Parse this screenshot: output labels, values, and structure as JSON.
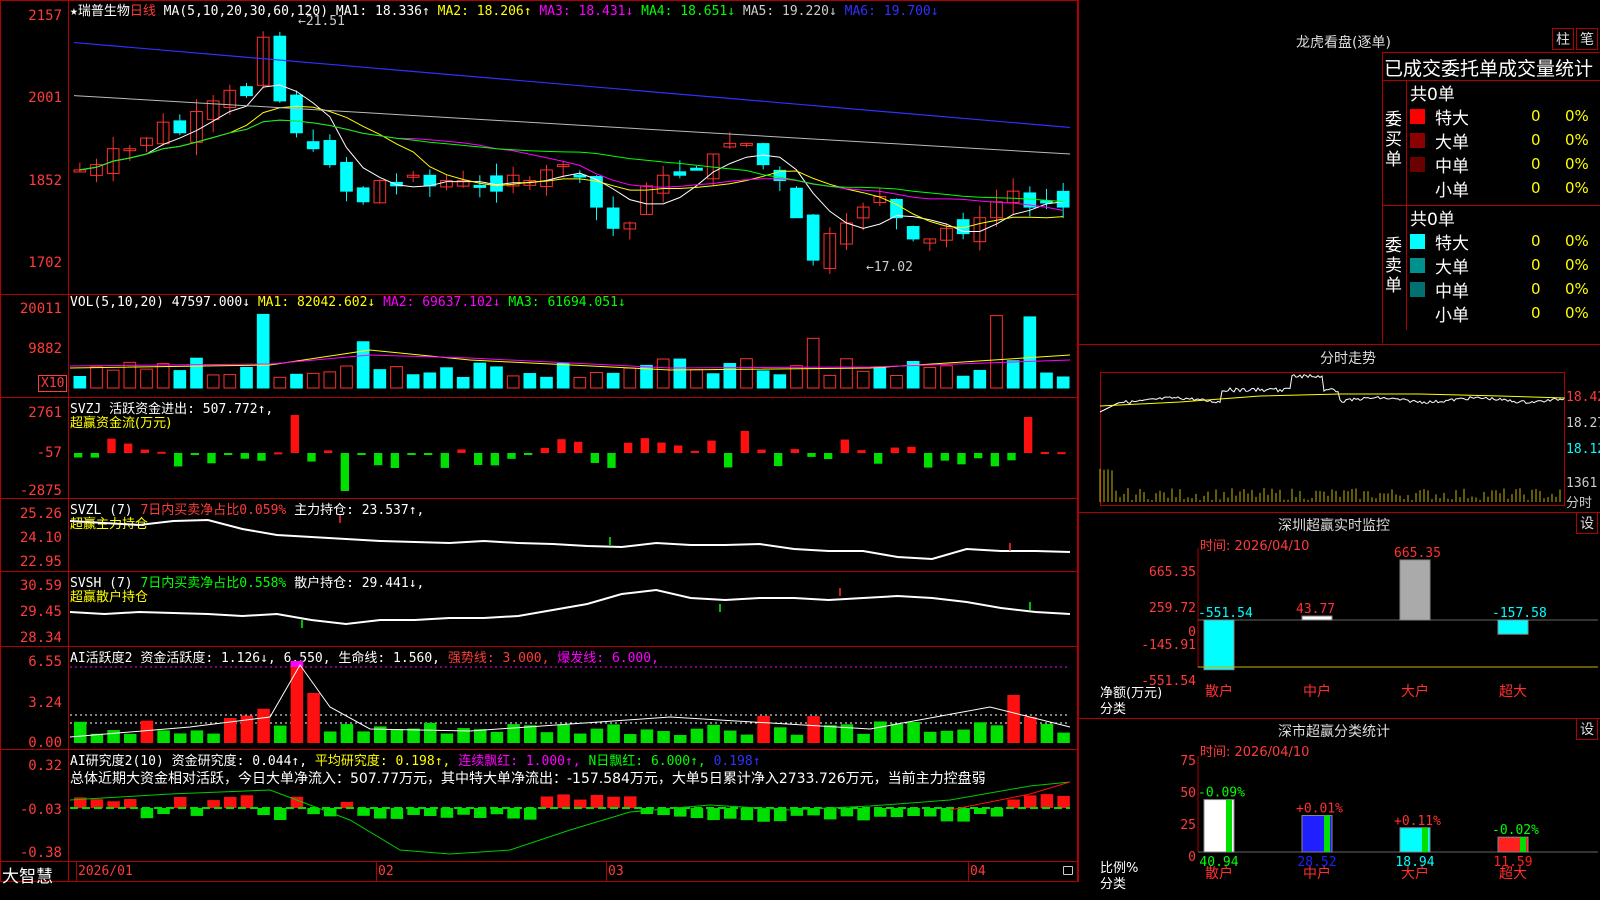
{
  "header": {
    "stock_label": "★瑞普生物",
    "period": "日线",
    "ma_def": "MA(5,10,20,30,60,120)",
    "ma1": "MA1: 18.336↑",
    "ma2": "MA2: 18.206↑",
    "ma3": "MA3: 18.431↓",
    "ma4": "MA4: 18.651↓",
    "ma5": "MA5: 19.220↓",
    "ma6": "MA6: 19.700↓"
  },
  "main_chart": {
    "y_ticks": [
      "2157",
      "2001",
      "1852",
      "1702"
    ],
    "high_label": "←21.51",
    "low_label": "←17.02"
  },
  "vol": {
    "def": "VOL(5,10,20)",
    "value": "47597.000↓",
    "ma1": "MA1: 82042.602↓",
    "ma2": "MA2: 69637.102↓",
    "ma3": "MA3: 61694.051↓",
    "y_ticks": [
      "20011",
      "9882"
    ],
    "unit": "X10"
  },
  "svzj": {
    "line1": "SVZJ  活跃资金进出: 507.772↑,",
    "line2": "超赢资金流(万元)",
    "y_ticks": [
      "2761",
      "-57",
      "-2875"
    ]
  },
  "svzl": {
    "def": "SVZL (7)",
    "ratio": "7日内买卖净占比0.059%",
    "hold": "主力持仓: 23.537↑,",
    "title": "超赢主力持仓",
    "y_ticks": [
      "25.26",
      "24.10",
      "22.95"
    ]
  },
  "svsh": {
    "def": "SVSH (7)",
    "ratio": "7日内买卖净占比0.558%",
    "hold": "散户持仓: 29.441↓,",
    "title": "超赢散户持仓",
    "y_ticks": [
      "30.59",
      "29.45",
      "28.34"
    ]
  },
  "ai_active": {
    "def": "AI活跃度2",
    "fund": "资金活跃度: 1.126↓,",
    "v2": "6.550,",
    "life": "生命线: 1.560,",
    "strong": "强势线: 3.000,",
    "burst": "爆发线: 6.000,",
    "y_ticks": [
      "6.55",
      "3.24",
      "0.00"
    ]
  },
  "ai_research": {
    "def": "AI研究度2(10)",
    "fund": "资金研究度: 0.044↑,",
    "avg": "平均研究度: 0.198↑,",
    "red": "连续飘红: 1.000↑,",
    "nred": "N日飘红: 6.000↑,",
    "v": "0.198↑",
    "summary": "总体近期大资金相对活跃，今日大单净流入：507.77万元，其中特大单净流出：-157.584万元，大单5日累计净入2733.726万元，当前主力控盘弱",
    "y_ticks": [
      "0.32",
      "-0.03",
      "-0.38"
    ]
  },
  "bottom_bar": {
    "brand": "大智慧",
    "dates": [
      "2026/01",
      "02",
      "03",
      "04"
    ]
  },
  "dragon": {
    "title": "龙虎看盘(逐单)",
    "btn_bar": "柱",
    "btn_pen": "笔",
    "subtitle": "已成交委托单成交量统计",
    "buy_label": "委买单",
    "sell_label": "委卖单",
    "buy_total": "共0单",
    "sell_total": "共0单",
    "buy_rows": [
      {
        "name": "特大",
        "count": "0",
        "pct": "0%",
        "color": "#ff0000"
      },
      {
        "name": "大单",
        "count": "0",
        "pct": "0%",
        "color": "#8b0000"
      },
      {
        "name": "中单",
        "count": "0",
        "pct": "0%",
        "color": "#6b0000"
      },
      {
        "name": "小单",
        "count": "0",
        "pct": "0%",
        "color": ""
      }
    ],
    "sell_rows": [
      {
        "name": "特大",
        "count": "0",
        "pct": "0%",
        "color": "#00ffff"
      },
      {
        "name": "大单",
        "count": "0",
        "pct": "0%",
        "color": "#009090"
      },
      {
        "name": "中单",
        "count": "0",
        "pct": "0%",
        "color": "#007070"
      },
      {
        "name": "小单",
        "count": "0",
        "pct": "0%",
        "color": ""
      }
    ]
  },
  "intraday": {
    "title": "分时走势",
    "y_ticks": [
      "18.42",
      "18.27",
      "18.12"
    ],
    "vol_tick": "1361",
    "unit": "分时"
  },
  "sz_monitor": {
    "title": "深圳超赢实时监控",
    "settings": "设",
    "time": "时间: 2026/04/10",
    "y_ticks": [
      "665.35",
      "259.72",
      "0",
      "-145.91",
      "-551.54"
    ],
    "y_label": "净额(万元)",
    "x_label": "分类",
    "categories": [
      "散户",
      "中户",
      "大户",
      "超大"
    ],
    "values": [
      -551.54,
      43.77,
      665.35,
      -157.58
    ],
    "value_labels": [
      "-551.54",
      "43.77",
      "665.35",
      "-157.58"
    ]
  },
  "sz_class": {
    "title": "深市超赢分类统计",
    "settings": "设",
    "time": "时间: 2026/04/10",
    "y_ticks": [
      "75",
      "50",
      "25",
      "0"
    ],
    "y_label": "比例%",
    "x_label": "分类",
    "categories": [
      "散户",
      "中户",
      "大户",
      "超大"
    ],
    "values": [
      40.94,
      28.52,
      18.94,
      11.59
    ],
    "change_labels": [
      "-0.09%",
      "+0.01%",
      "+0.11%",
      "-0.02%"
    ],
    "value_labels": [
      "40.94",
      "28.52",
      "18.94",
      "11.59"
    ]
  },
  "chart_data": {
    "type": "bar",
    "title": "深圳超赢实时监控",
    "categories": [
      "散户",
      "中户",
      "大户",
      "超大"
    ],
    "series": [
      {
        "name": "净额(万元)",
        "values": [
          -551.54,
          43.77,
          665.35,
          -157.58
        ]
      },
      {
        "name": "比例%",
        "values": [
          40.94,
          28.52,
          18.94,
          11.59
        ]
      }
    ]
  }
}
